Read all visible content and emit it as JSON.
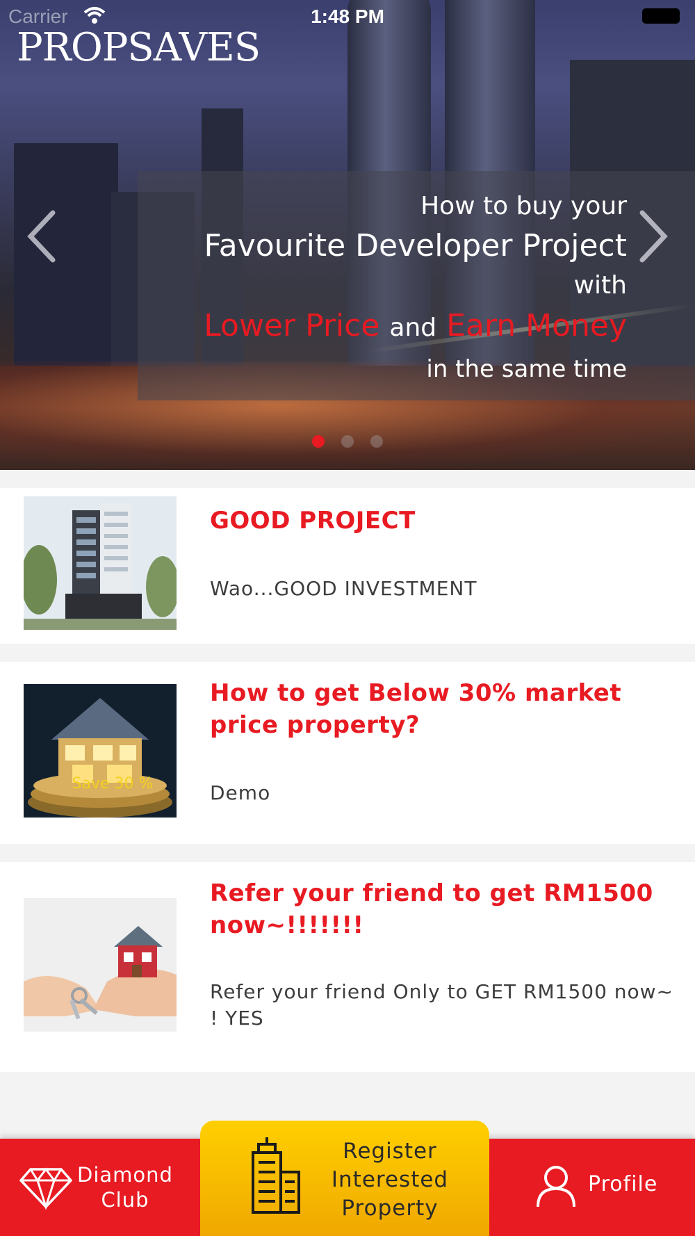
{
  "status_bar": {
    "carrier": "Carrier",
    "time": "1:48 PM"
  },
  "brand": {
    "logo_text": "PROPSAVES"
  },
  "hero": {
    "line1": "How to buy your",
    "line2": "Favourite Developer Project",
    "line3": "with",
    "line4_red_a": "Lower Price",
    "line4_and": "and",
    "line4_red_b": "Earn Money",
    "line5": "in the same time",
    "slide_count": 3,
    "active_slide": 1
  },
  "cards": [
    {
      "title": "GOOD PROJECT",
      "description": "Wao...GOOD INVESTMENT",
      "image": "building-photo"
    },
    {
      "title": "How to get Below 30% market price property?",
      "description": "Demo",
      "image": "house-on-coins-photo",
      "image_caption": "Save 30 %"
    },
    {
      "title": "Refer your friend to get RM1500 now~!!!!!!!",
      "description": "Refer your friend Only  to  GET  RM1500 now~ ! YES",
      "image": "hands-keys-house-photo"
    }
  ],
  "tabbar": {
    "diamond_label_1": "Diamond",
    "diamond_label_2": "Club",
    "register_label_1": "Register",
    "register_label_2": "Interested",
    "register_label_3": "Property",
    "profile_label": "Profile"
  },
  "colors": {
    "brand_red": "#e81a22",
    "register_yellow": "#ffcf00",
    "text_dark": "#3d3d3d"
  }
}
